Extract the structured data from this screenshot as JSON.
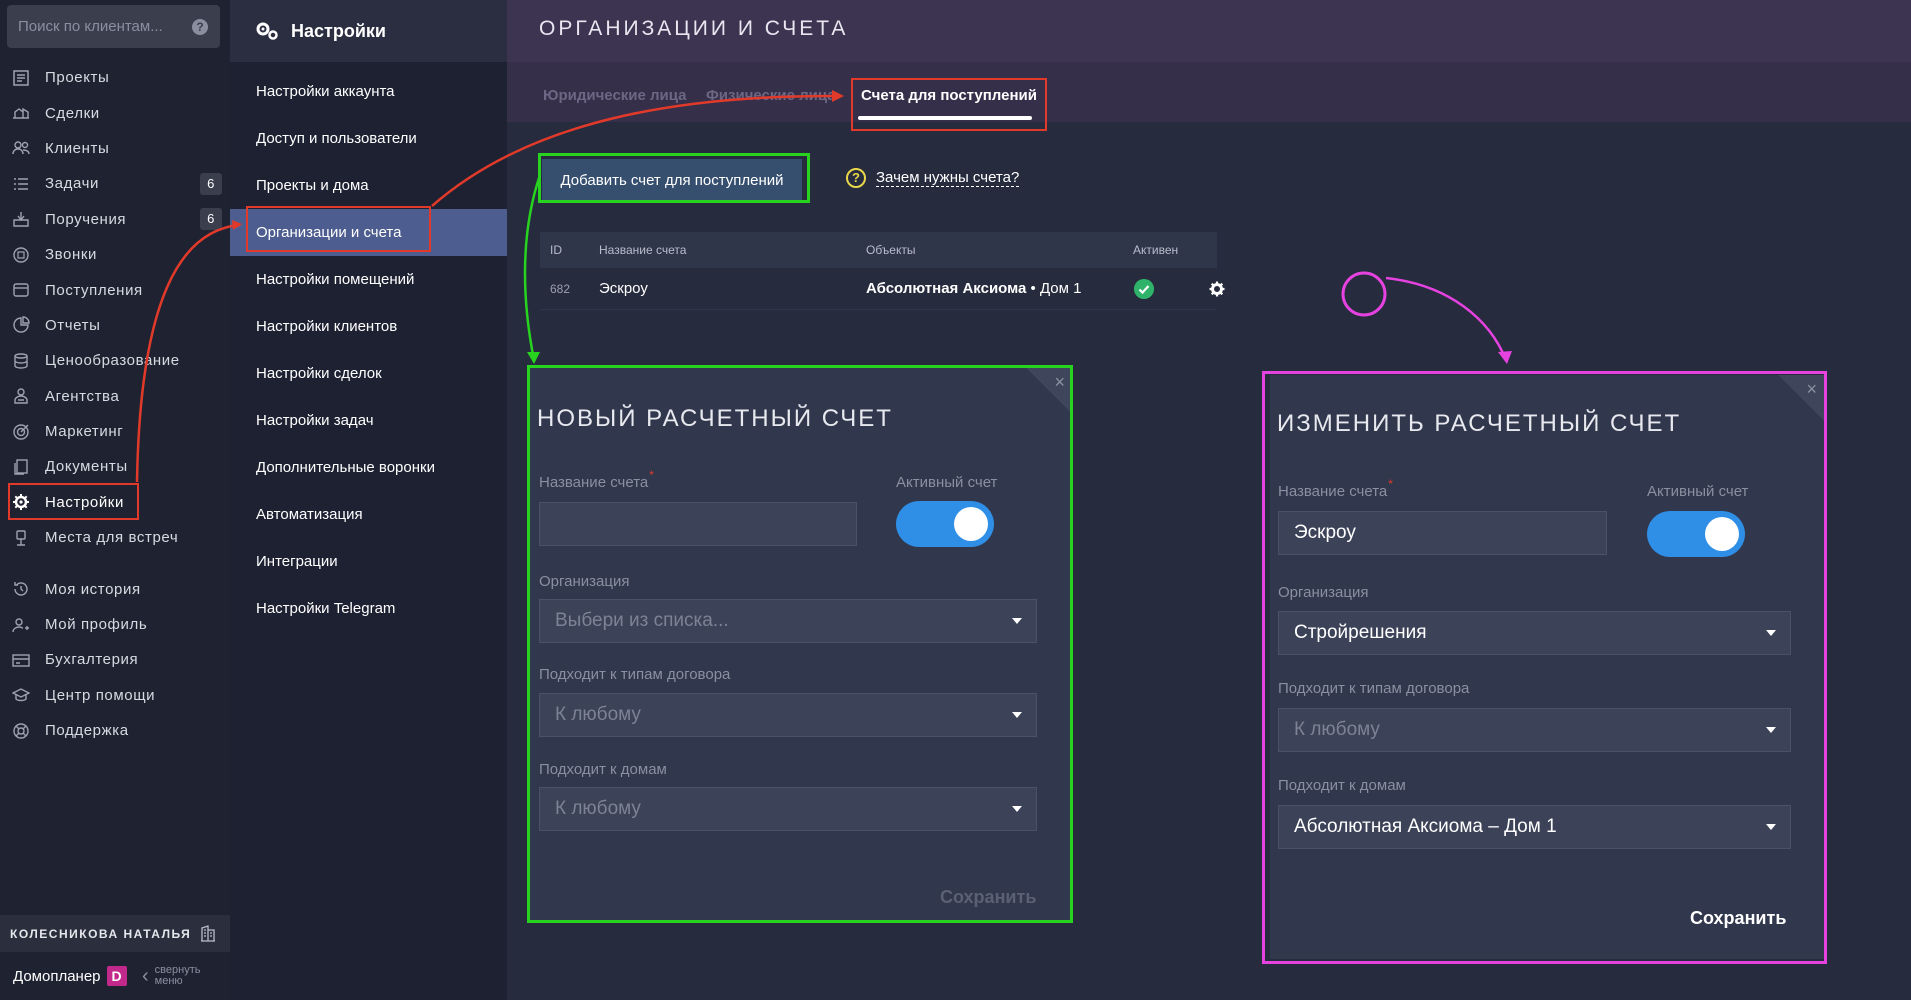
{
  "search": {
    "placeholder": "Поиск по клиентам...",
    "help": "?"
  },
  "nav": {
    "items": [
      {
        "icon": "projects-icon",
        "label": "Проекты",
        "badge": ""
      },
      {
        "icon": "deals-icon",
        "label": "Сделки",
        "badge": ""
      },
      {
        "icon": "clients-icon",
        "label": "Клиенты",
        "badge": ""
      },
      {
        "icon": "tasks-icon",
        "label": "Задачи",
        "badge": "6"
      },
      {
        "icon": "assignments-icon",
        "label": "Поручения",
        "badge": "6"
      },
      {
        "icon": "calls-icon",
        "label": "Звонки",
        "badge": ""
      },
      {
        "icon": "income-icon",
        "label": "Поступления",
        "badge": ""
      },
      {
        "icon": "reports-icon",
        "label": "Отчеты",
        "badge": ""
      },
      {
        "icon": "pricing-icon",
        "label": "Ценообразование",
        "badge": ""
      },
      {
        "icon": "agencies-icon",
        "label": "Агентства",
        "badge": ""
      },
      {
        "icon": "marketing-icon",
        "label": "Маркетинг",
        "badge": ""
      },
      {
        "icon": "documents-icon",
        "label": "Документы",
        "badge": ""
      },
      {
        "icon": "settings-gear-icon",
        "label": "Настройки",
        "badge": ""
      },
      {
        "icon": "meeting-places-icon",
        "label": "Места для встреч",
        "badge": ""
      }
    ],
    "bottom_items": [
      {
        "icon": "history-icon",
        "label": "Моя история"
      },
      {
        "icon": "profile-icon",
        "label": "Мой профиль"
      },
      {
        "icon": "accounting-icon",
        "label": "Бухгалтерия"
      },
      {
        "icon": "help-center-icon",
        "label": "Центр помощи"
      },
      {
        "icon": "support-icon",
        "label": "Поддержка"
      }
    ],
    "user_name": "КОЛЕСНИКОВА НАТАЛЬЯ",
    "brand": "Домопланер",
    "brand_logo": "D",
    "collapse_line1": "свернуть",
    "collapse_line2": "меню"
  },
  "settings": {
    "title": "Настройки",
    "items": [
      "Настройки аккаунта",
      "Доступ и пользователи",
      "Проекты и дома",
      "Организации и счета",
      "Настройки помещений",
      "Настройки клиентов",
      "Настройки сделок",
      "Настройки задач",
      "Дополнительные воронки",
      "Автоматизация",
      "Интеграции",
      "Настройки Telegram"
    ],
    "active_index": 3
  },
  "page": {
    "title": "ОРГАНИЗАЦИИ И СЧЕТА",
    "tabs": [
      "Юридические лица",
      "Физические лица",
      "Счета для поступлений"
    ],
    "add_button": "Добавить счет для поступлений",
    "help_link": "Зачем нужны счета?",
    "help_glyph": "?"
  },
  "table": {
    "headers": {
      "id": "ID",
      "name": "Название счета",
      "objects": "Объекты",
      "active": "Активен"
    },
    "rows": [
      {
        "id": "682",
        "name": "Эскроу",
        "objects_bold": "Абсолютная Аксиома",
        "objects_rest": " • Дом 1",
        "active": true
      }
    ]
  },
  "new_dialog": {
    "title": "НОВЫЙ РАСЧЕТНЫЙ СЧЕТ",
    "name_label": "Название счета",
    "required_mark": "*",
    "name_value": "",
    "active_label": "Активный счет",
    "org_label": "Организация",
    "org_value": "Выбери из списка...",
    "contract_label": "Подходит к типам договора",
    "contract_value": "К любому",
    "houses_label": "Подходит к домам",
    "houses_value": "К любому",
    "save": "Сохранить",
    "close": "×"
  },
  "edit_dialog": {
    "title": "ИЗМЕНИТЬ РАСЧЕТНЫЙ СЧЕТ",
    "name_label": "Название счета",
    "required_mark": "*",
    "name_value": "Эскроу",
    "active_label": "Активный счет",
    "org_label": "Организация",
    "org_value": "Стройрешения",
    "contract_label": "Подходит к типам договора",
    "contract_value": "К любому",
    "houses_label": "Подходит к домам",
    "houses_value": "Абсолютная Аксиома – Дом 1",
    "save": "Сохранить",
    "close": "×"
  },
  "colors": {
    "accent_red": "#e23a2a",
    "accent_green": "#27d31f",
    "accent_pink": "#e542e0",
    "toggle_blue": "#2f8ee5"
  }
}
